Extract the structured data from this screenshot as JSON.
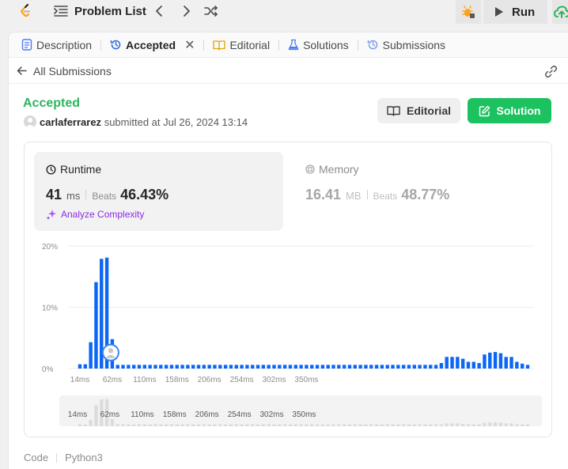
{
  "topbar": {
    "problem_list_label": "Problem List",
    "run_label": "Run"
  },
  "tabs": [
    {
      "label": "Description",
      "icon": "description-icon"
    },
    {
      "label": "Accepted",
      "icon": "history-icon",
      "active": true
    },
    {
      "label": "Editorial",
      "icon": "book-icon"
    },
    {
      "label": "Solutions",
      "icon": "flask-icon"
    },
    {
      "label": "Submissions",
      "icon": "history-icon"
    }
  ],
  "subbar": {
    "back_label": "All Submissions"
  },
  "submission": {
    "status": "Accepted",
    "username": "carlaferrarez",
    "submitted_text": "submitted at Jul 26, 2024 13:14"
  },
  "actions": {
    "editorial_label": "Editorial",
    "solution_label": "Solution"
  },
  "runtime": {
    "label": "Runtime",
    "value": "41",
    "unit": "ms",
    "beats_label": "Beats",
    "beats_value": "46.43%",
    "analyze_label": "Analyze Complexity"
  },
  "memory": {
    "label": "Memory",
    "value": "16.41",
    "unit": "MB",
    "beats_label": "Beats",
    "beats_value": "48.77%"
  },
  "colors": {
    "accepted": "#2db55d",
    "solution_button": "#1cc25f",
    "bar": "#0a66f5",
    "analyze": "#8a2be2"
  },
  "chart_data": {
    "type": "bar",
    "xlabel": "",
    "ylabel": "",
    "ylim": [
      0,
      20
    ],
    "y_ticks": [
      "20%",
      "10%",
      "0%"
    ],
    "x_tick_labels": [
      "14ms",
      "62ms",
      "110ms",
      "158ms",
      "206ms",
      "254ms",
      "302ms",
      "350ms"
    ],
    "highlight_index": 6,
    "values": [
      0.7,
      0.7,
      4.3,
      14.1,
      17.9,
      18.1,
      4.8,
      0.6,
      0.6,
      0.6,
      0.6,
      0.6,
      0.6,
      0.6,
      0.6,
      0.6,
      0.6,
      0.6,
      0.6,
      0.6,
      0.6,
      0.6,
      0.6,
      0.6,
      0.6,
      0.6,
      0.6,
      0.6,
      0.6,
      0.6,
      0.6,
      0.6,
      0.6,
      0.6,
      0.6,
      0.6,
      0.6,
      0.6,
      0.6,
      0.6,
      0.6,
      0.6,
      0.6,
      0.6,
      0.6,
      0.6,
      0.6,
      0.6,
      0.6,
      0.6,
      0.6,
      0.6,
      0.6,
      0.6,
      0.6,
      0.6,
      0.6,
      0.6,
      0.6,
      0.6,
      0.6,
      0.6,
      0.6,
      0.6,
      0.6,
      0.6,
      0.6,
      0.9,
      1.9,
      1.9,
      1.9,
      1.6,
      1.1,
      1.1,
      0.9,
      2.3,
      2.6,
      2.7,
      2.5,
      1.9,
      1.9,
      1.1,
      0.8,
      0.6
    ]
  }
}
